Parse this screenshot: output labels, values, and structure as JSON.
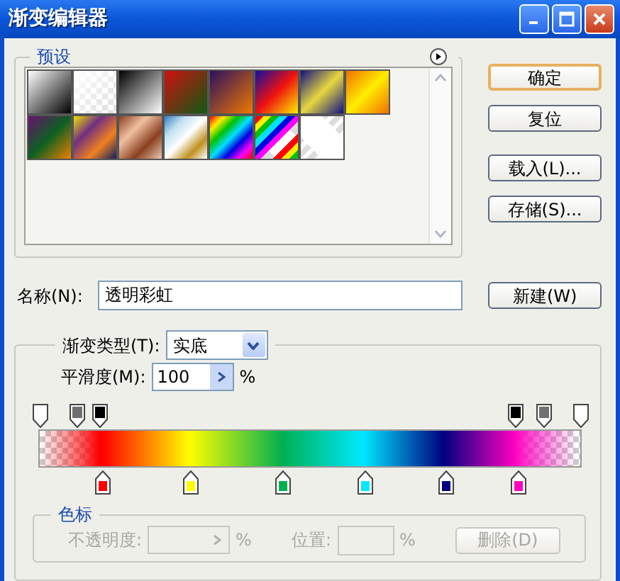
{
  "window": {
    "title": "渐变编辑器"
  },
  "presets": {
    "legend": "预设"
  },
  "buttons": [
    {
      "label": "确定",
      "default": true
    },
    {
      "label": "复位",
      "default": false
    },
    {
      "label": "载入(L)...",
      "default": false
    },
    {
      "label": "存储(S)...",
      "default": false
    }
  ],
  "name_field": {
    "label": "名称(N):",
    "value": "透明彩虹"
  },
  "new_button": {
    "label": "新建(W)"
  },
  "gradient_type": {
    "label": "渐变类型(T):",
    "value": "实底"
  },
  "smoothness": {
    "label": "平滑度(M):",
    "value": "100",
    "unit": "%"
  },
  "gradient": {
    "opacity_stops": [
      {
        "level": 0,
        "color": "#ffffff"
      },
      {
        "level": 0.068,
        "color": "#707070"
      },
      {
        "level": 0.11,
        "color": "#000000"
      },
      {
        "level": 0.877,
        "color": "#000000"
      },
      {
        "level": 0.927,
        "color": "#707070"
      },
      {
        "level": 0.995,
        "color": "#ffffff"
      }
    ],
    "color_stops": [
      {
        "level": 0.117,
        "color": "#ff0000"
      },
      {
        "level": 0.277,
        "color": "#ffff00"
      },
      {
        "level": 0.449,
        "color": "#00b050"
      },
      {
        "level": 0.598,
        "color": "#00e8ff"
      },
      {
        "level": 0.747,
        "color": "#000080"
      },
      {
        "level": 0.88,
        "color": "#ff00c0"
      }
    ]
  },
  "stops_panel": {
    "legend": "色标",
    "opacity_label": "不透明度:",
    "opacity_unit": "%",
    "position_label": "位置:",
    "position_unit": "%",
    "delete_button": "删除(D)",
    "disabled": true
  }
}
